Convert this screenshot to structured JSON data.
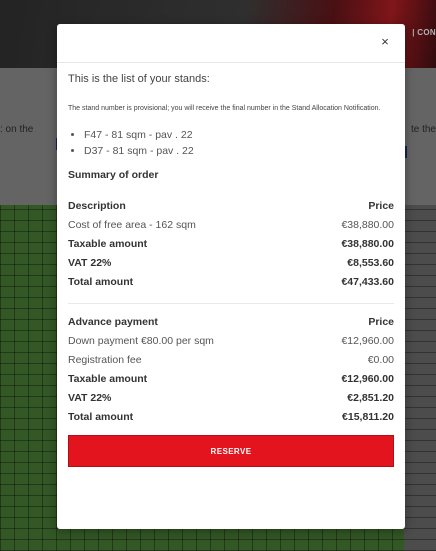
{
  "background": {
    "header_link": "| CON",
    "left_text": ": on the",
    "right_text": "te the"
  },
  "modal": {
    "close_label": "×",
    "intro": "This is the list of your stands:",
    "notice": "The stand number is provisional; you will receive the final number in the Stand Allocation Notification.",
    "stands": [
      "F47 - 81 sqm - pav . 22",
      "D37 - 81 sqm - pav . 22"
    ],
    "summary_title": "Summary of order",
    "summary": {
      "header": {
        "label": "Description",
        "value": "Price"
      },
      "rows": [
        {
          "label": "Cost of free area - 162 sqm",
          "value": "€38,880.00",
          "bold": false
        },
        {
          "label": "Taxable amount",
          "value": "€38,880.00",
          "bold": true
        },
        {
          "label": "VAT 22%",
          "value": "€8,553.60",
          "bold": true
        },
        {
          "label": "Total amount",
          "value": "€47,433.60",
          "bold": true
        }
      ]
    },
    "advance": {
      "header": {
        "label": "Advance payment",
        "value": "Price"
      },
      "rows": [
        {
          "label": "Down payment €80.00 per sqm",
          "value": "€12,960.00",
          "bold": false
        },
        {
          "label": "Registration fee",
          "value": "€0.00",
          "bold": false
        },
        {
          "label": "Taxable amount",
          "value": "€12,960.00",
          "bold": true
        },
        {
          "label": "VAT 22%",
          "value": "€2,851.20",
          "bold": true
        },
        {
          "label": "Total amount",
          "value": "€15,811.20",
          "bold": true
        }
      ]
    },
    "reserve_label": "RESERVE"
  },
  "colors": {
    "accent": "#e3141e"
  }
}
